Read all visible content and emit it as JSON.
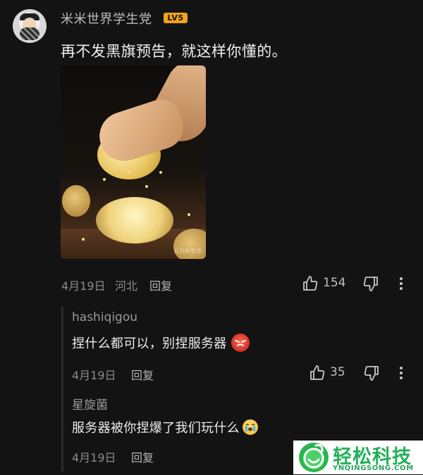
{
  "comment": {
    "username": "米米世界学生党",
    "level_badge": "LV5",
    "text": "再不发黑旗预告，就这样你懂的。",
    "image_watermark": "豆包AI生成",
    "date": "4月19日",
    "location": "河北",
    "reply_label": "回复",
    "like_count": "154"
  },
  "replies": [
    {
      "username": "hashiqigou",
      "text": "捏什么都可以，别捏服务器",
      "emoji": "angry-face-emoji",
      "date": "4月19日",
      "reply_label": "回复",
      "like_count": "35"
    },
    {
      "username": "星旋菌",
      "text": "服务器被你捏爆了我们玩什么",
      "emoji": "crying-face-emoji",
      "date": "4月19日",
      "reply_label": "回复"
    }
  ],
  "watermark": {
    "name": "轻松科技",
    "domain": "YNQINGSONG.COM"
  },
  "colors": {
    "background": "#131313",
    "badge": "#f0a21b",
    "brand_green": "#23b05a"
  }
}
